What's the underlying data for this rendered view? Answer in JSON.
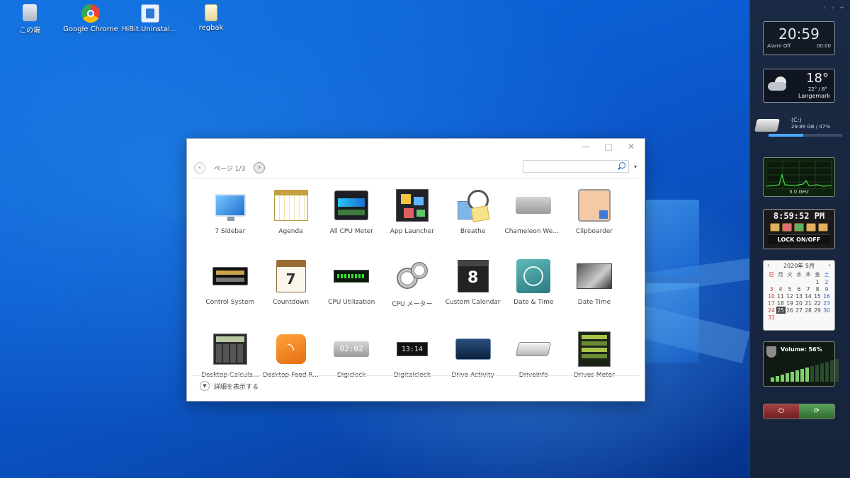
{
  "desktop": {
    "icons": [
      {
        "label": "この端",
        "icon": "recycle-bin-icon"
      },
      {
        "label": "Google Chrome",
        "icon": "chrome-icon"
      },
      {
        "label": "HiBit.Uninstaller...",
        "icon": "installer-icon"
      },
      {
        "label": "regbak",
        "icon": "folder-icon"
      }
    ]
  },
  "window": {
    "controls": {
      "minimize": "—",
      "maximize": "□",
      "close": "✕"
    },
    "toolbar": {
      "prev": "‹",
      "page_label": "ページ 1/3",
      "next": "›",
      "search_placeholder": "",
      "search_dropdown": "▾"
    },
    "gadgets": [
      {
        "name": "7 Sidebar",
        "icon": "monitor-icon"
      },
      {
        "name": "Agenda",
        "icon": "agenda-calendar-icon"
      },
      {
        "name": "All CPU Meter",
        "icon": "cpu-meter-icon"
      },
      {
        "name": "App Launcher",
        "icon": "app-launcher-icon"
      },
      {
        "name": "Breathe",
        "icon": "clock-notes-icon"
      },
      {
        "name": "Chameleon Wea...",
        "icon": "weather-panel-icon"
      },
      {
        "name": "Clipboarder",
        "icon": "clipboard-photo-icon"
      },
      {
        "name": "Control System",
        "icon": "control-panel-icon"
      },
      {
        "name": "Countdown",
        "icon": "countdown-calendar-icon"
      },
      {
        "name": "CPU Utilization",
        "icon": "cpu-graph-icon"
      },
      {
        "name": "CPU メーター",
        "icon": "cpu-gauge-icon"
      },
      {
        "name": "Custom Calendar",
        "icon": "custom-calendar-icon"
      },
      {
        "name": "Date & Time",
        "icon": "teal-clock-icon"
      },
      {
        "name": "Date Time",
        "icon": "date-time-photo-icon"
      },
      {
        "name": "Desktop Calcula...",
        "icon": "calculator-icon"
      },
      {
        "name": "Desktop Feed R...",
        "icon": "rss-icon"
      },
      {
        "name": "Digiclock",
        "icon": "digiclock-icon"
      },
      {
        "name": "Digitalclock",
        "icon": "digitalclock-icon"
      },
      {
        "name": "Drive Activity",
        "icon": "drive-activity-icon"
      },
      {
        "name": "DriveInfo",
        "icon": "drive-info-icon"
      },
      {
        "name": "Drives Meter",
        "icon": "drives-meter-icon"
      }
    ],
    "icon_texts": {
      "countdown_day": "7",
      "custom_calendar_day": "8",
      "digiclock_time": "02:02",
      "digitalclock_time": "13:14"
    },
    "details_label": "詳細を表示する"
  },
  "sidebar": {
    "top_controls": [
      "‹",
      "›",
      "+"
    ],
    "clock": {
      "time": "20:59",
      "alarm": "Alarm Off",
      "alarm_time": "00:00"
    },
    "weather": {
      "temp": "18°",
      "range": "22° / 8°",
      "city": "Langemark",
      "icon": "partly-cloudy-icon"
    },
    "drive": {
      "label": "(C:)",
      "detail": "29.86 GB / 47%",
      "percent": 47
    },
    "cpu": {
      "freq": "3.0 GHz"
    },
    "digital_clock": {
      "time": "8:59:52 PM",
      "lock_label": "LOCK ON/OFF"
    },
    "calendar": {
      "month": "2020年 5月",
      "weekdays": [
        "日",
        "月",
        "火",
        "水",
        "木",
        "金",
        "土"
      ],
      "weeks": [
        [
          "",
          "",
          "",
          "",
          "",
          "1",
          "2"
        ],
        [
          "3",
          "4",
          "5",
          "6",
          "7",
          "8",
          "9"
        ],
        [
          "10",
          "11",
          "12",
          "13",
          "14",
          "15",
          "16"
        ],
        [
          "17",
          "18",
          "19",
          "20",
          "21",
          "22",
          "23"
        ],
        [
          "24",
          "25",
          "26",
          "27",
          "28",
          "29",
          "30"
        ],
        [
          "31",
          "",
          "",
          "",
          "",
          "",
          ""
        ]
      ],
      "today": "25"
    },
    "volume": {
      "label": "Volume: 56%",
      "percent": 56
    },
    "power": {
      "off": "⏻",
      "on": "⟳"
    }
  },
  "colors": {
    "desktop_blue": "#0a56c9",
    "sidebar_bg": "#1b2a44",
    "accent": "#4aa6ff"
  }
}
